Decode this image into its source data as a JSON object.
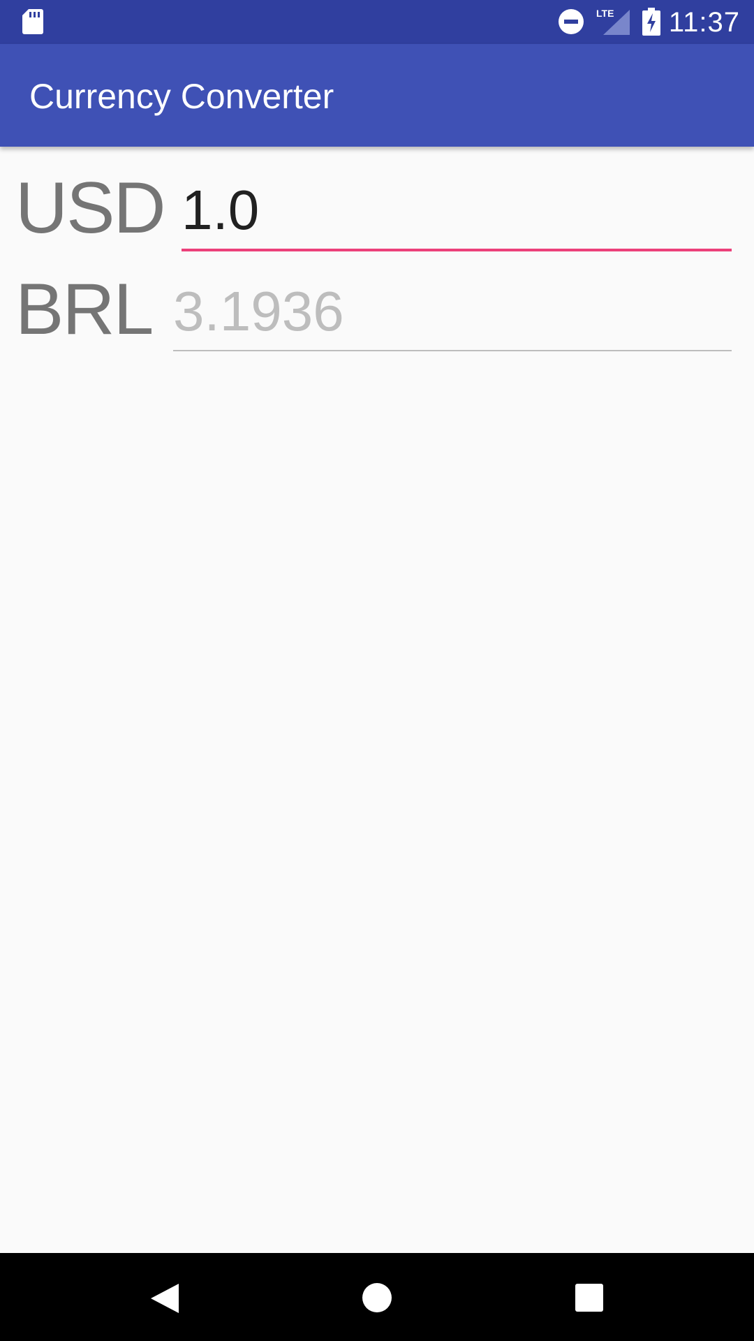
{
  "status_bar": {
    "time": "11:37",
    "network_label": "LTE",
    "icons": [
      "sd-card-icon",
      "do-not-disturb-icon",
      "lte-signal-icon",
      "battery-charging-icon"
    ]
  },
  "app_bar": {
    "title": "Currency Converter"
  },
  "converter": {
    "from": {
      "currency": "USD",
      "value": "1.0"
    },
    "to": {
      "currency": "BRL",
      "placeholder": "3.1936"
    }
  },
  "nav_bar": {
    "icons": [
      "back-icon",
      "home-icon",
      "recents-icon"
    ]
  },
  "colors": {
    "status_bar": "#303f9f",
    "app_bar": "#3f51b5",
    "accent": "#ec407a",
    "background": "#fafafa"
  }
}
